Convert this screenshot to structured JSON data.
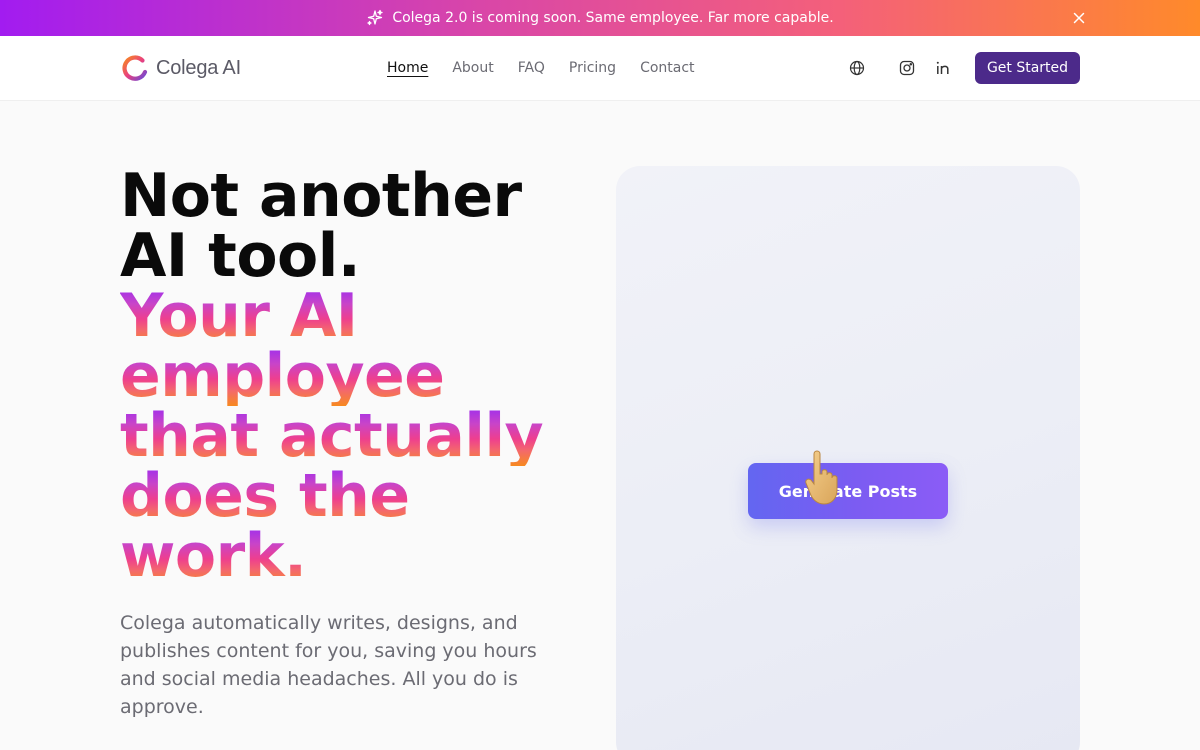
{
  "banner": {
    "text": "Colega 2.0 is coming soon. Same employee. Far more capable.",
    "icon": "sparkles-icon",
    "close_icon": "close-icon"
  },
  "header": {
    "logo_text": "Colega AI",
    "nav": [
      {
        "label": "Home",
        "active": true
      },
      {
        "label": "About",
        "active": false
      },
      {
        "label": "FAQ",
        "active": false
      },
      {
        "label": "Pricing",
        "active": false
      },
      {
        "label": "Contact",
        "active": false
      }
    ],
    "icons": [
      "globe-icon",
      "instagram-icon",
      "linkedin-icon"
    ],
    "cta_label": "Get Started"
  },
  "hero": {
    "title_lines_dark": [
      "Not another",
      "AI tool."
    ],
    "title_lines_gradient": [
      "Your AI",
      "employee",
      "that actually",
      "does the",
      "work."
    ],
    "subtitle": "Colega automatically writes, designs, and publishes content for you, saving you hours and social media headaches. All you do is approve."
  },
  "demo": {
    "button_label": "Generate Posts",
    "cursor_icon": "pointing-hand-icon"
  },
  "colors": {
    "accent_purple": "#4c2a8a",
    "button_indigo": "#6366f1",
    "gradient_start": "#a21cf0",
    "gradient_end": "#ff8a2a"
  }
}
